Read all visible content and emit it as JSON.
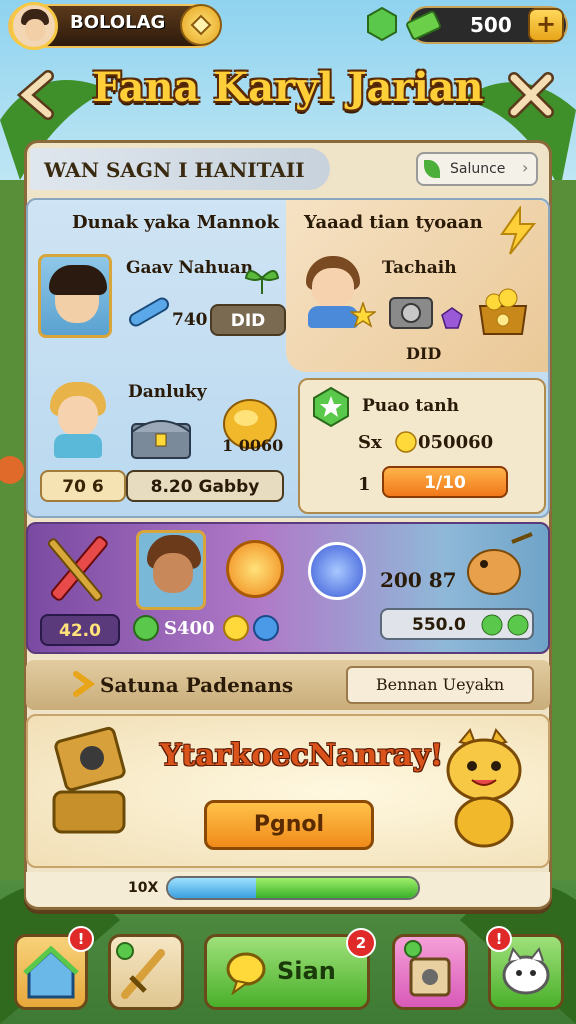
{
  "topbar": {
    "player_name": "BOLOLAG",
    "currency_value": "500",
    "plus_label": "+"
  },
  "title": "Fana Karyl Jarian",
  "nav": {
    "back_icon": "chevron-left-icon",
    "close_icon": "close-icon"
  },
  "header": {
    "title": "WAN SAGN I HANITAII",
    "button_label": "Salunce"
  },
  "section1": {
    "left_title": "Dunak yaka Mannok",
    "right_title": "Yaaad tian tyoaan",
    "hero1": {
      "name": "Gaav Nahuan",
      "value": "740",
      "pill": "DID"
    },
    "hero2": {
      "name": "Tachaih",
      "value": "DID"
    },
    "hero3": {
      "name": "Danluky",
      "value_left": "70 6",
      "value_mid": "8.20 Gabby",
      "value_right": "1 0060"
    },
    "card": {
      "title": "Puao tanh",
      "stat_prefix": "Sx",
      "stat_value": "050060",
      "count": "1",
      "button_label": "1/10"
    }
  },
  "section2": {
    "value1": "42.0",
    "value2": "S400",
    "value3": "200 87",
    "value4": "550.0"
  },
  "section3": {
    "title": "Satuna Padenans",
    "button_label": "Bennan Ueyakn"
  },
  "reward": {
    "title": "YtarkoecNanray!",
    "button_label": "Pgnol"
  },
  "progress": {
    "label": "10X",
    "blue_fraction": 0.35,
    "green_fraction": 0.65
  },
  "bottom_nav": {
    "items": [
      {
        "icon": "home-icon",
        "badge": "!"
      },
      {
        "icon": "sword-icon",
        "badge": ""
      },
      {
        "icon": "chat-icon",
        "label": "Sian",
        "badge": "2"
      },
      {
        "icon": "gift-icon",
        "badge": ""
      },
      {
        "icon": "pet-icon",
        "badge": "!"
      }
    ]
  }
}
